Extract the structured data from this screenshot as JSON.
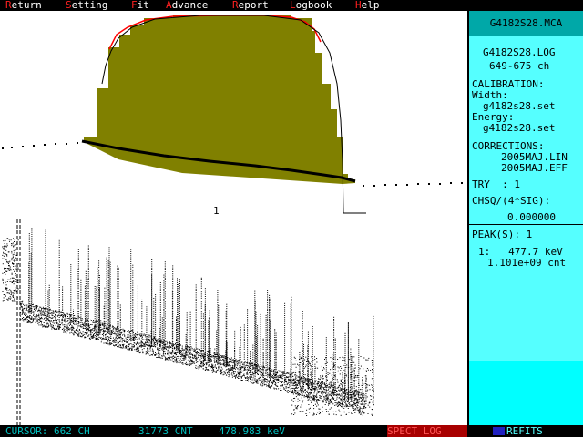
{
  "menu": [
    {
      "hotkey": "R",
      "rest": "eturn"
    },
    {
      "hotkey": "S",
      "rest": "etting"
    },
    {
      "hotkey": "F",
      "rest": "it"
    },
    {
      "hotkey": "A",
      "rest": "dvance"
    },
    {
      "hotkey": "R",
      "rest": "eport"
    },
    {
      "hotkey": "L",
      "rest": "ogbook"
    },
    {
      "hotkey": "H",
      "rest": "elp"
    }
  ],
  "upper_plot": {
    "peak_marker": "1"
  },
  "side": {
    "filename": "G4182S28.MCA",
    "logfile": "G4182S28.LOG",
    "channel_range": "649-675 ch",
    "calibration_label": "CALIBRATION:",
    "width_label": "Width:",
    "width_value": "g4182s28.set",
    "energy_label": "Energy:",
    "energy_value": "g4182s28.set",
    "corrections_label": "CORRECTIONS:",
    "correction_1": "2005MAJ.LIN",
    "correction_2": "2005MAJ.EFF",
    "try_label": "TRY  : 1",
    "chsq_label": "CHSQ/(4*SIG):",
    "chsq_value": "0.000000",
    "peaks_label": "PEAK(S): 1",
    "peak_line1": "1:   477.7 keV",
    "peak_line2": "1.101e+09 cnt"
  },
  "status": {
    "cursor": "CURSOR: 662 CH",
    "counts": "31773 CNT",
    "energy": "478.983 keV",
    "spect_log": "SPECT LOG",
    "refits": "REFITS"
  },
  "colors": {
    "fill": "#808000",
    "fit_curve": "#ff0000",
    "panel": "#55ffff",
    "header": "#00a8a8",
    "menu_hotkey": "#ff2020",
    "status_text": "#00c0c0"
  }
}
